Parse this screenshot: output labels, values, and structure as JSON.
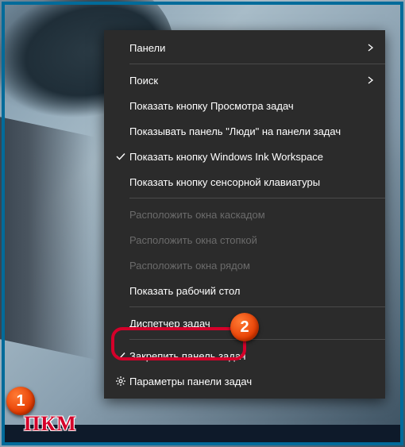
{
  "menu": {
    "items": [
      {
        "label": "Панели",
        "submenu": true
      },
      {
        "sep": true
      },
      {
        "label": "Поиск",
        "submenu": true
      },
      {
        "label": "Показать кнопку Просмотра задач"
      },
      {
        "label": "Показывать панель \"Люди\" на панели задач"
      },
      {
        "label": "Показать кнопку Windows Ink Workspace",
        "checked": true
      },
      {
        "label": "Показать кнопку сенсорной клавиатуры"
      },
      {
        "sep": true
      },
      {
        "label": "Расположить окна каскадом",
        "disabled": true
      },
      {
        "label": "Расположить окна стопкой",
        "disabled": true
      },
      {
        "label": "Расположить окна рядом",
        "disabled": true
      },
      {
        "label": "Показать рабочий стол"
      },
      {
        "sep": true
      },
      {
        "label": "Диспетчер задач"
      },
      {
        "sep": true
      },
      {
        "label": "Закрепить панель задач",
        "checked": true
      },
      {
        "label": "Параметры панели задач",
        "gear": true
      }
    ]
  },
  "annotations": {
    "badge1": "1",
    "badge2": "2",
    "pkm": "ПКМ"
  }
}
